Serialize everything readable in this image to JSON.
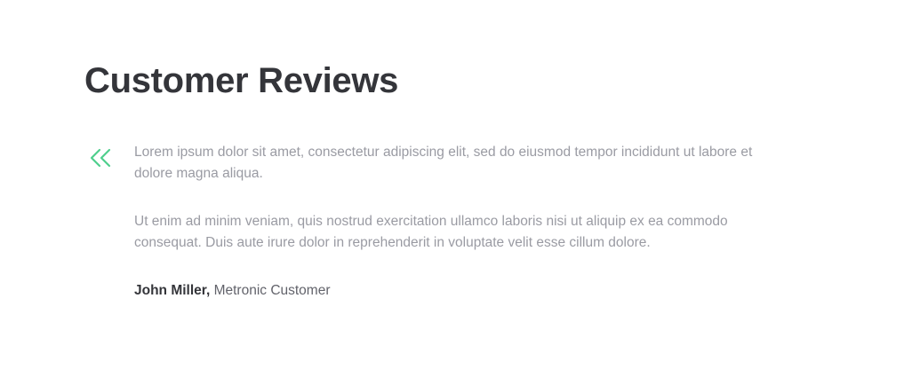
{
  "page": {
    "title": "Customer Reviews"
  },
  "review": {
    "quote_icon": "double-chevron-left-icon",
    "accent_color": "#4fcf8d",
    "paragraphs": [
      "Lorem ipsum dolor sit amet, consectetur adipiscing elit, sed do eiusmod tempor incididunt ut labore et dolore magna aliqua.",
      "Ut enim ad minim veniam, quis nostrud exercitation ullamco laboris nisi ut aliquip ex ea commodo consequat. Duis aute irure dolor in reprehenderit in voluptate velit esse cillum dolore."
    ],
    "author_name": "John Miller,",
    "author_role": " Metronic Customer"
  }
}
